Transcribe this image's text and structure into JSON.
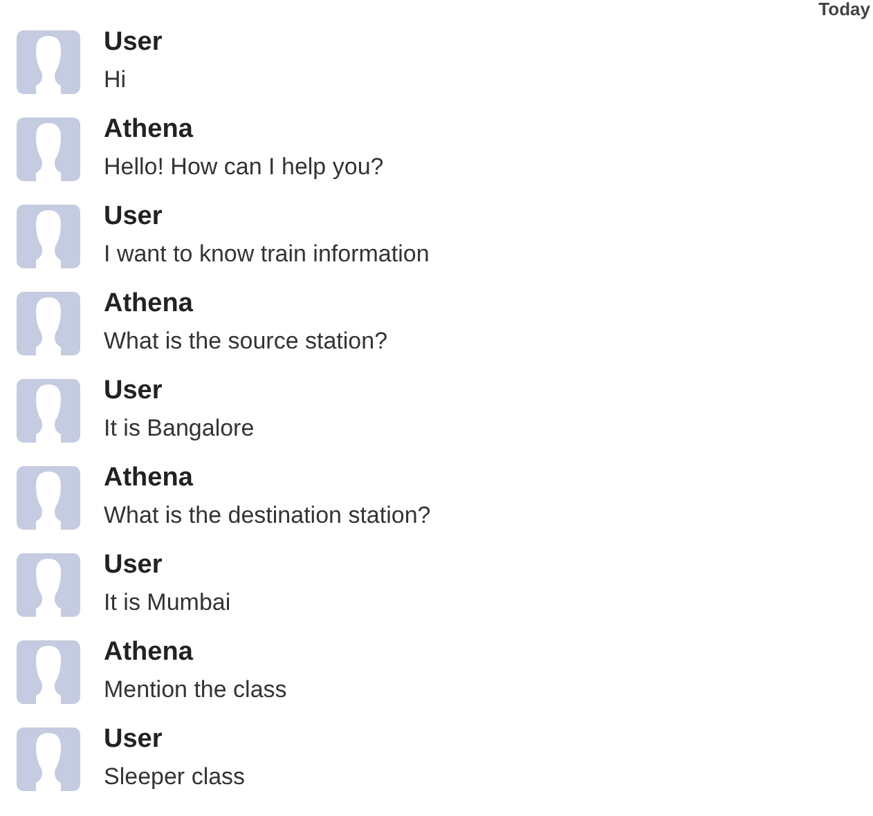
{
  "date_label": "Today",
  "messages": [
    {
      "sender": "User",
      "text": "Hi"
    },
    {
      "sender": "Athena",
      "text": "Hello! How can I help you?"
    },
    {
      "sender": "User",
      "text": "I want to know train information"
    },
    {
      "sender": "Athena",
      "text": "What is the source station?"
    },
    {
      "sender": "User",
      "text": "It is Bangalore"
    },
    {
      "sender": "Athena",
      "text": "What is the destination station?"
    },
    {
      "sender": "User",
      "text": "It is Mumbai"
    },
    {
      "sender": "Athena",
      "text": "Mention the class"
    },
    {
      "sender": "User",
      "text": "Sleeper class"
    }
  ]
}
